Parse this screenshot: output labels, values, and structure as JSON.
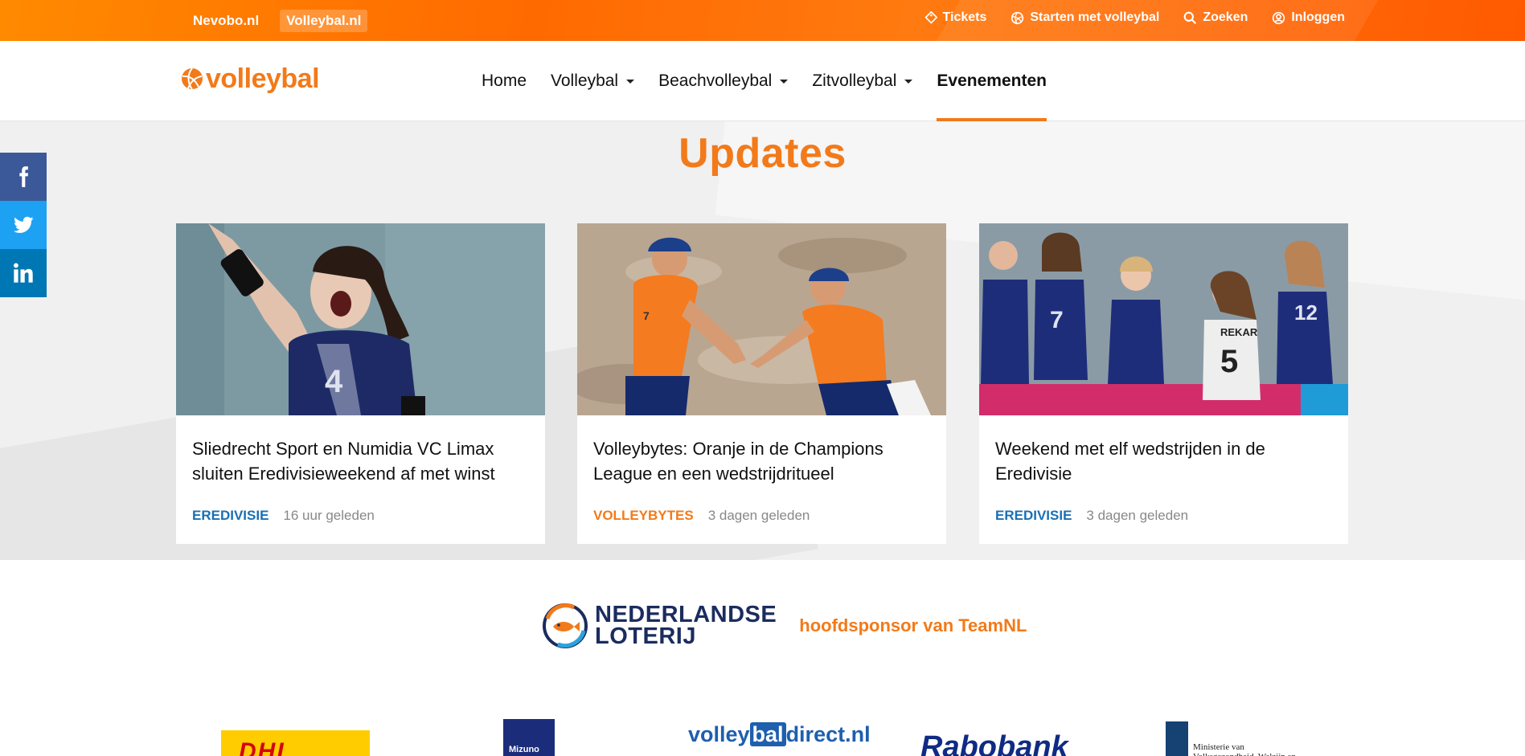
{
  "topbar": {
    "site_links": [
      {
        "label": "Nevobo.nl",
        "active": false
      },
      {
        "label": "Volleybal.nl",
        "active": true
      }
    ],
    "actions": [
      {
        "label": "Tickets",
        "icon": "ticket-icon"
      },
      {
        "label": "Starten met volleybal",
        "icon": "volleyball-icon"
      },
      {
        "label": "Zoeken",
        "icon": "search-icon"
      },
      {
        "label": "Inloggen",
        "icon": "user-icon"
      }
    ]
  },
  "nav": {
    "logo_text": "volleybal",
    "items": [
      {
        "label": "Home",
        "dropdown": false,
        "active": false
      },
      {
        "label": "Volleybal",
        "dropdown": true,
        "active": false
      },
      {
        "label": "Beachvolleybal",
        "dropdown": true,
        "active": false
      },
      {
        "label": "Zitvolleybal",
        "dropdown": true,
        "active": false
      },
      {
        "label": "Evenementen",
        "dropdown": false,
        "active": true
      }
    ]
  },
  "updates": {
    "title": "Updates",
    "cards": [
      {
        "title": "Sliedrecht Sport en Numidia VC Limax sluiten Eredivisieweekend af met winst",
        "category": "EREDIVISIE",
        "category_color": "#1a6fb5",
        "time": "16 uur geleden"
      },
      {
        "title": "Volleybytes: Oranje in de Champions League en een wedstrijdritueel",
        "category": "VOLLEYBYTES",
        "category_color": "#f27a1a",
        "time": "3 dagen geleden"
      },
      {
        "title": "Weekend met elf wedstrijden in de Eredivisie",
        "category": "EREDIVISIE",
        "category_color": "#1a6fb5",
        "time": "3 dagen geleden"
      }
    ]
  },
  "social": [
    {
      "name": "facebook-icon"
    },
    {
      "name": "twitter-icon"
    },
    {
      "name": "linkedin-icon"
    }
  ],
  "sponsor": {
    "name_line1": "NEDERLANDSE",
    "name_line2": "LOTERIJ",
    "tagline": "hoofdsponsor van TeamNL"
  },
  "partners": {
    "dhl": "DHL",
    "mizuno": "Mizuno",
    "volleybaldirect_pre": "volley",
    "volleybaldirect_mid": "bal",
    "volleybaldirect_post": "direct.nl",
    "rabobank": "Rabobank",
    "ministerie": "Ministerie van Volksgezondheid, Welzijn en Sport"
  },
  "colors": {
    "brand_orange": "#f27a1a",
    "eredivisie_blue": "#1a6fb5"
  }
}
